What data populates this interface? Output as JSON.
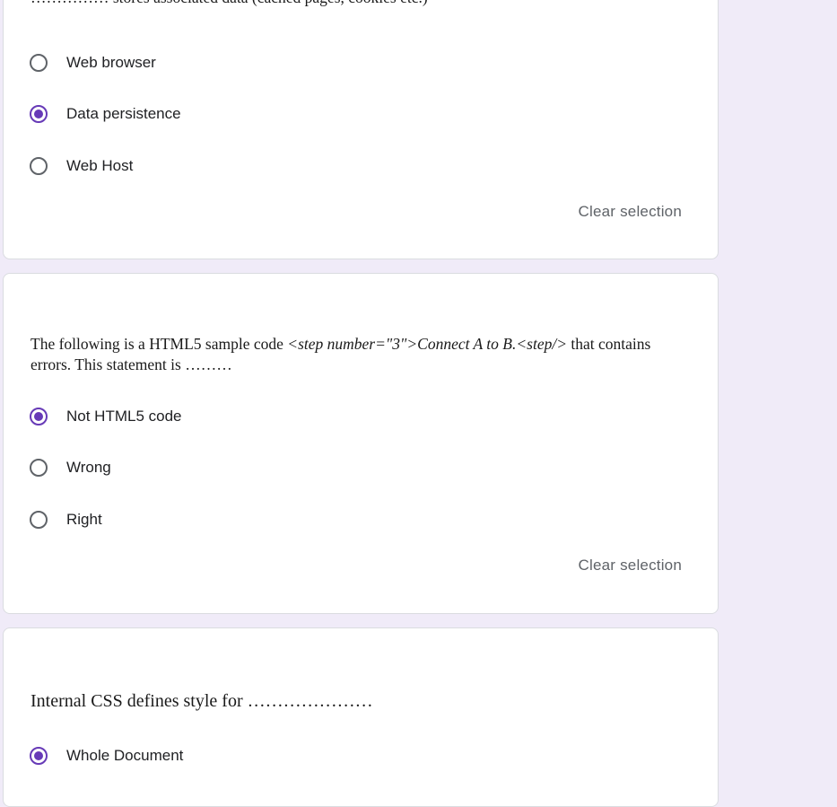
{
  "questions": [
    {
      "text": "…………… stores associated data (cached pages, cookies etc.)",
      "options": [
        "Web browser",
        "Data persistence",
        "Web Host"
      ],
      "selected_index": 1,
      "clear_label": "Clear selection"
    },
    {
      "text_before": "The following is a HTML5 sample code ",
      "code": "<step number=\"3\">Connect A to B.<step/>",
      "text_after": " that contains errors. This statement is ………",
      "options": [
        "Not HTML5 code",
        "Wrong",
        "Right"
      ],
      "selected_index": 0,
      "clear_label": "Clear selection"
    },
    {
      "text": "Internal CSS defines style for …………………",
      "options": [
        "Whole Document"
      ],
      "selected_index": 0
    }
  ],
  "colors": {
    "accent": "#673ab7",
    "background": "#f0ebf8",
    "card": "#ffffff",
    "radio_unchecked": "#5f6368"
  }
}
